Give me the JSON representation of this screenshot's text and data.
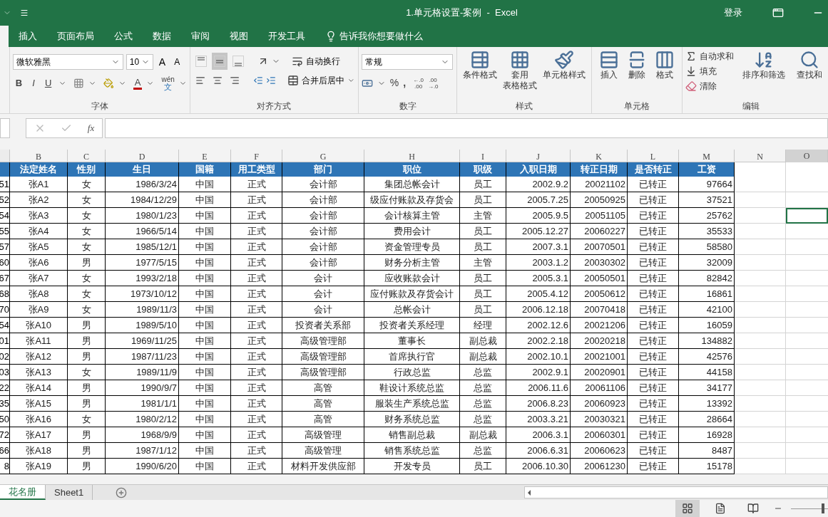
{
  "title_bar": {
    "title": "1.单元格设置-案例  -  Excel",
    "sign_in": "登录"
  },
  "ribbon_tabs": [
    "插入",
    "页面布局",
    "公式",
    "数据",
    "审阅",
    "视图",
    "开发工具"
  ],
  "tell_me": "告诉我你想要做什么",
  "font_group": {
    "label": "字体",
    "font_name": "微软雅黑",
    "font_size": "10",
    "grow": "A",
    "shrink": "A",
    "bold": "B",
    "italic": "I",
    "underline": "U",
    "font_color": "A",
    "phonetic_top": "wén",
    "phonetic_bottom": "文"
  },
  "alignment_group": {
    "label": "对齐方式",
    "vertical_align": [
      {
        "kind": "top",
        "selected": false
      },
      {
        "kind": "middle",
        "selected": true
      },
      {
        "kind": "bottom",
        "selected": false
      }
    ],
    "wrap_text": "自动换行",
    "merge_center": "合并后居中"
  },
  "number_group": {
    "label": "数字",
    "format": "常规",
    "percent": "%",
    "comma": ",",
    "increase_decimal": [
      "←.0",
      ".00"
    ],
    "decrease_decimal": [
      ".00",
      "→.0"
    ]
  },
  "styles_group": {
    "label": "样式",
    "buttons": [
      {
        "kind": "conditional",
        "lines": [
          "条件格式"
        ]
      },
      {
        "kind": "table",
        "lines": [
          "套用",
          "表格格式"
        ]
      },
      {
        "kind": "cell_style",
        "lines": [
          "单元格样式"
        ]
      }
    ]
  },
  "cells_group": {
    "label": "单元格",
    "buttons": [
      {
        "kind": "insert",
        "lines": [
          "插入"
        ]
      },
      {
        "kind": "delete",
        "lines": [
          "删除"
        ]
      },
      {
        "kind": "format",
        "lines": [
          "格式"
        ]
      }
    ]
  },
  "editing_group": {
    "label": "编辑",
    "items": [
      {
        "kind": "sum",
        "label": "自动求和"
      },
      {
        "kind": "fill",
        "label": "填充"
      },
      {
        "kind": "clear",
        "label": "清除"
      }
    ],
    "buttons": [
      {
        "kind": "sort",
        "lines": [
          "排序和筛选"
        ]
      },
      {
        "kind": "find",
        "lines": [
          "查找和"
        ]
      }
    ]
  },
  "formula_bar": {
    "fx": "fx"
  },
  "sheet": {
    "columns": [
      {
        "letter": "B",
        "selected": false
      },
      {
        "letter": "C",
        "selected": false
      },
      {
        "letter": "D",
        "selected": false
      },
      {
        "letter": "E",
        "selected": false
      },
      {
        "letter": "F",
        "selected": false
      },
      {
        "letter": "G",
        "selected": false
      },
      {
        "letter": "H",
        "selected": false
      },
      {
        "letter": "I",
        "selected": false
      },
      {
        "letter": "J",
        "selected": false
      },
      {
        "letter": "K",
        "selected": false
      },
      {
        "letter": "L",
        "selected": false
      },
      {
        "letter": "M",
        "selected": false
      },
      {
        "letter": "N",
        "selected": false
      },
      {
        "letter": "O",
        "selected": true
      }
    ],
    "header": [
      "法定姓名",
      "性别",
      "生日",
      "国籍",
      "用工类型",
      "部门",
      "职位",
      "职级",
      "入职日期",
      "转正日期",
      "是否转正",
      "工资"
    ],
    "rows": [
      {
        "a": "51",
        "cells": [
          "张A1",
          "女",
          "1986/3/24",
          "中国",
          "正式",
          "会计部",
          "集团总帐会计",
          "员工",
          "2002.9.2",
          "20021102",
          "已转正",
          "97664"
        ],
        "selected": false
      },
      {
        "a": "52",
        "cells": [
          "张A2",
          "女",
          "1984/12/29",
          "中国",
          "正式",
          "会计部",
          "级应付账款及存货会",
          "员工",
          "2005.7.25",
          "20050925",
          "已转正",
          "37521"
        ],
        "selected": false
      },
      {
        "a": "54",
        "cells": [
          "张A3",
          "女",
          "1980/1/23",
          "中国",
          "正式",
          "会计部",
          "会计核算主管",
          "主管",
          "2005.9.5",
          "20051105",
          "已转正",
          "25762"
        ],
        "selected": true
      },
      {
        "a": "55",
        "cells": [
          "张A4",
          "女",
          "1966/5/14",
          "中国",
          "正式",
          "会计部",
          "费用会计",
          "员工",
          "2005.12.27",
          "20060227",
          "已转正",
          "35533"
        ],
        "selected": false
      },
      {
        "a": "57",
        "cells": [
          "张A5",
          "女",
          "1985/12/1",
          "中国",
          "正式",
          "会计部",
          "资金管理专员",
          "员工",
          "2007.3.1",
          "20070501",
          "已转正",
          "58580"
        ],
        "selected": false
      },
      {
        "a": "60",
        "cells": [
          "张A6",
          "男",
          "1977/5/15",
          "中国",
          "正式",
          "会计部",
          "财务分析主管",
          "主管",
          "2003.1.2",
          "20030302",
          "已转正",
          "32009"
        ],
        "selected": false
      },
      {
        "a": "67",
        "cells": [
          "张A7",
          "女",
          "1993/2/18",
          "中国",
          "正式",
          "会计",
          "应收账款会计",
          "员工",
          "2005.3.1",
          "20050501",
          "已转正",
          "82842"
        ],
        "selected": false
      },
      {
        "a": "68",
        "cells": [
          "张A8",
          "女",
          "1973/10/12",
          "中国",
          "正式",
          "会计",
          "应付账款及存货会计",
          "员工",
          "2005.4.12",
          "20050612",
          "已转正",
          "16861"
        ],
        "selected": false
      },
      {
        "a": "70",
        "cells": [
          "张A9",
          "女",
          "1989/11/3",
          "中国",
          "正式",
          "会计",
          "总帐会计",
          "员工",
          "2006.12.18",
          "20070418",
          "已转正",
          "42100"
        ],
        "selected": false
      },
      {
        "a": "54",
        "cells": [
          "张A10",
          "男",
          "1989/5/10",
          "中国",
          "正式",
          "投资者关系部",
          "投资者关系经理",
          "经理",
          "2002.12.6",
          "20021206",
          "已转正",
          "16059"
        ],
        "selected": false
      },
      {
        "a": "01",
        "cells": [
          "张A11",
          "男",
          "1969/11/25",
          "中国",
          "正式",
          "高级管理部",
          "董事长",
          "副总裁",
          "2002.2.18",
          "20020218",
          "已转正",
          "134882"
        ],
        "selected": false
      },
      {
        "a": "02",
        "cells": [
          "张A12",
          "男",
          "1987/11/23",
          "中国",
          "正式",
          "高级管理部",
          "首席执行官",
          "副总裁",
          "2002.10.1",
          "20021001",
          "已转正",
          "42576"
        ],
        "selected": false
      },
      {
        "a": "03",
        "cells": [
          "张A13",
          "女",
          "1989/11/9",
          "中国",
          "正式",
          "高级管理部",
          "行政总监",
          "总监",
          "2002.9.1",
          "20020901",
          "已转正",
          "44158"
        ],
        "selected": false
      },
      {
        "a": "22",
        "cells": [
          "张A14",
          "男",
          "1990/9/7",
          "中国",
          "正式",
          "高管",
          "鞋设计系统总监",
          "总监",
          "2006.11.6",
          "20061106",
          "已转正",
          "34177"
        ],
        "selected": false
      },
      {
        "a": "35",
        "cells": [
          "张A15",
          "男",
          "1981/1/1",
          "中国",
          "正式",
          "高管",
          "服装生产系统总监",
          "总监",
          "2006.8.23",
          "20060923",
          "已转正",
          "13392"
        ],
        "selected": false
      },
      {
        "a": "50",
        "cells": [
          "张A16",
          "女",
          "1980/2/12",
          "中国",
          "正式",
          "高管",
          "财务系统总监",
          "总监",
          "2003.3.21",
          "20030321",
          "已转正",
          "28664"
        ],
        "selected": false
      },
      {
        "a": "72",
        "cells": [
          "张A17",
          "男",
          "1968/9/9",
          "中国",
          "正式",
          "高级管理",
          "销售副总裁",
          "副总裁",
          "2006.3.1",
          "20060301",
          "已转正",
          "16928"
        ],
        "selected": false
      },
      {
        "a": "66",
        "cells": [
          "张A18",
          "男",
          "1987/1/12",
          "中国",
          "正式",
          "高级管理",
          "销售系统总监",
          "总监",
          "2006.6.31",
          "20060623",
          "已转正",
          "8487"
        ],
        "selected": false
      },
      {
        "a": "8",
        "cells": [
          "张A19",
          "男",
          "1990/6/20",
          "中国",
          "正式",
          "材料开发供应部",
          "开发专员",
          "员工",
          "2006.10.30",
          "20061230",
          "已转正",
          "15178"
        ],
        "selected": false
      }
    ]
  },
  "sheet_tabs": [
    {
      "label": "花名册",
      "selected": true
    },
    {
      "label": "Sheet1",
      "selected": false
    }
  ],
  "view_buttons": [
    {
      "kind": "normal",
      "selected": true
    },
    {
      "kind": "page_layout",
      "selected": false
    },
    {
      "kind": "page_break",
      "selected": false
    }
  ],
  "zoom": {
    "level": 0.9
  }
}
